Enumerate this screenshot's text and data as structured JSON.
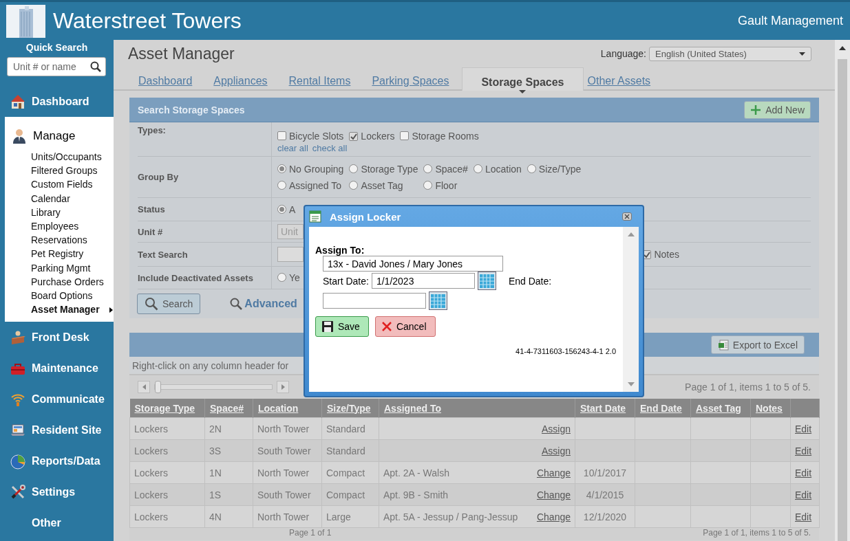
{
  "header": {
    "title": "Waterstreet Towers",
    "company": "Gault Management"
  },
  "sidebar": {
    "search_title": "Quick Search",
    "search_placeholder": "Unit # or name",
    "items": [
      {
        "label": "Dashboard",
        "expanded": false
      },
      {
        "label": "Manage",
        "expanded": true,
        "children": [
          {
            "label": "Units/Occupants",
            "selected": false
          },
          {
            "label": "Filtered Groups",
            "selected": false
          },
          {
            "label": "Custom Fields",
            "selected": false
          },
          {
            "label": "Calendar",
            "selected": false
          },
          {
            "label": "Library",
            "selected": false
          },
          {
            "label": "Employees",
            "selected": false
          },
          {
            "label": "Reservations",
            "selected": false
          },
          {
            "label": "Pet Registry",
            "selected": false
          },
          {
            "label": "Parking Mgmt",
            "selected": false
          },
          {
            "label": "Purchase Orders",
            "selected": false
          },
          {
            "label": "Board Options",
            "selected": false
          },
          {
            "label": "Asset Manager",
            "selected": true
          }
        ]
      },
      {
        "label": "Front Desk",
        "expanded": false
      },
      {
        "label": "Maintenance",
        "expanded": false
      },
      {
        "label": "Communicate",
        "expanded": false
      },
      {
        "label": "Resident Site",
        "expanded": false
      },
      {
        "label": "Reports/Data",
        "expanded": false
      },
      {
        "label": "Settings",
        "expanded": false
      },
      {
        "label": "Other",
        "expanded": false
      }
    ]
  },
  "page": {
    "title": "Asset Manager",
    "language_label": "Language:",
    "language": "English (United States)",
    "tabs": [
      {
        "label": "Dashboard",
        "selected": false
      },
      {
        "label": "Appliances",
        "selected": false
      },
      {
        "label": "Rental Items",
        "selected": false
      },
      {
        "label": "Parking Spaces",
        "selected": false
      },
      {
        "label": "Storage Spaces",
        "selected": true
      },
      {
        "label": "Other Assets",
        "selected": false
      }
    ]
  },
  "search_panel": {
    "title": "Search Storage Spaces",
    "add_button": "Add New",
    "rows": [
      {
        "kind": "checks",
        "label": "Types:",
        "options": [
          {
            "label": "Bicycle Slots",
            "checked": false
          },
          {
            "label": "Lockers",
            "checked": true
          },
          {
            "label": "Storage Rooms",
            "checked": false
          }
        ],
        "links": [
          "clear all",
          "check all"
        ]
      },
      {
        "kind": "radios",
        "label": "Group By",
        "options": [
          {
            "label": "No Grouping",
            "selected": true
          },
          {
            "label": "Storage Type",
            "selected": false
          },
          {
            "label": "Space#",
            "selected": false
          },
          {
            "label": "Location",
            "selected": false
          },
          {
            "label": "Size/Type",
            "selected": false
          },
          {
            "label": "Assigned To",
            "selected": false
          },
          {
            "label": "Asset Tag",
            "selected": false
          },
          {
            "label": "Floor",
            "selected": false
          }
        ]
      },
      {
        "kind": "radios",
        "label": "Status",
        "options": [
          {
            "label": "A",
            "selected": true
          }
        ]
      },
      {
        "kind": "field",
        "label": "Unit #",
        "placeholder": "Unit"
      },
      {
        "kind": "text",
        "label": "Text Search",
        "options": [
          {
            "label": "Notes",
            "checked": true
          }
        ]
      },
      {
        "kind": "radios",
        "label": "Include Deactivated Assets",
        "options": [
          {
            "label": "Ye",
            "selected": false
          }
        ]
      }
    ],
    "search_button": "Search",
    "advanced_link": "Advanced"
  },
  "results": {
    "export_button": "Export to Excel",
    "hint": "Right-click on any column header for",
    "slider": {
      "level": 0
    },
    "pager_text": "Page 1 of 1, items 1 to 5 of 5.",
    "columns": [
      "Storage Type",
      "Space#",
      "Location",
      "Size/Type",
      "Assigned To",
      "Start Date",
      "End Date",
      "Asset Tag",
      "Notes"
    ],
    "rows": [
      {
        "storage_type": "Lockers",
        "space": "2N",
        "location": "North Tower",
        "size_type": "Standard",
        "action": "Assign",
        "edit": "Edit"
      },
      {
        "storage_type": "Lockers",
        "space": "3S",
        "location": "South Tower",
        "size_type": "Standard",
        "action": "Assign",
        "edit": "Edit"
      },
      {
        "storage_type": "Lockers",
        "space": "1N",
        "location": "North Tower",
        "size_type": "Compact",
        "assigned_to": "Apt. 2A - Walsh",
        "action": "Change",
        "start_date": "10/1/2017",
        "edit": "Edit"
      },
      {
        "storage_type": "Lockers",
        "space": "1S",
        "location": "South Tower",
        "size_type": "Compact",
        "assigned_to": "Apt. 9B - Smith",
        "action": "Change",
        "start_date": "4/1/2015",
        "edit": "Edit"
      },
      {
        "storage_type": "Lockers",
        "space": "4N",
        "location": "North Tower",
        "size_type": "Large",
        "assigned_to": "Apt. 5A - Jessup / Pang-Jessup",
        "action": "Change",
        "start_date": "12/1/2020",
        "edit": "Edit"
      }
    ],
    "bottom_pager": {
      "left": "Page 1 of 1",
      "right": "Page 1 of 1, items 1 to 5 of 5."
    }
  },
  "dialog": {
    "title": "Assign Locker",
    "assign_label": "Assign To:",
    "assign_value": "13x - David Jones / Mary Jones",
    "start_label": "Start Date:",
    "start_value": "1/1/2023",
    "end_label": "End Date:",
    "save": "Save",
    "cancel": "Cancel",
    "code": "41-4-7311603-156243-4-1 2.0"
  }
}
